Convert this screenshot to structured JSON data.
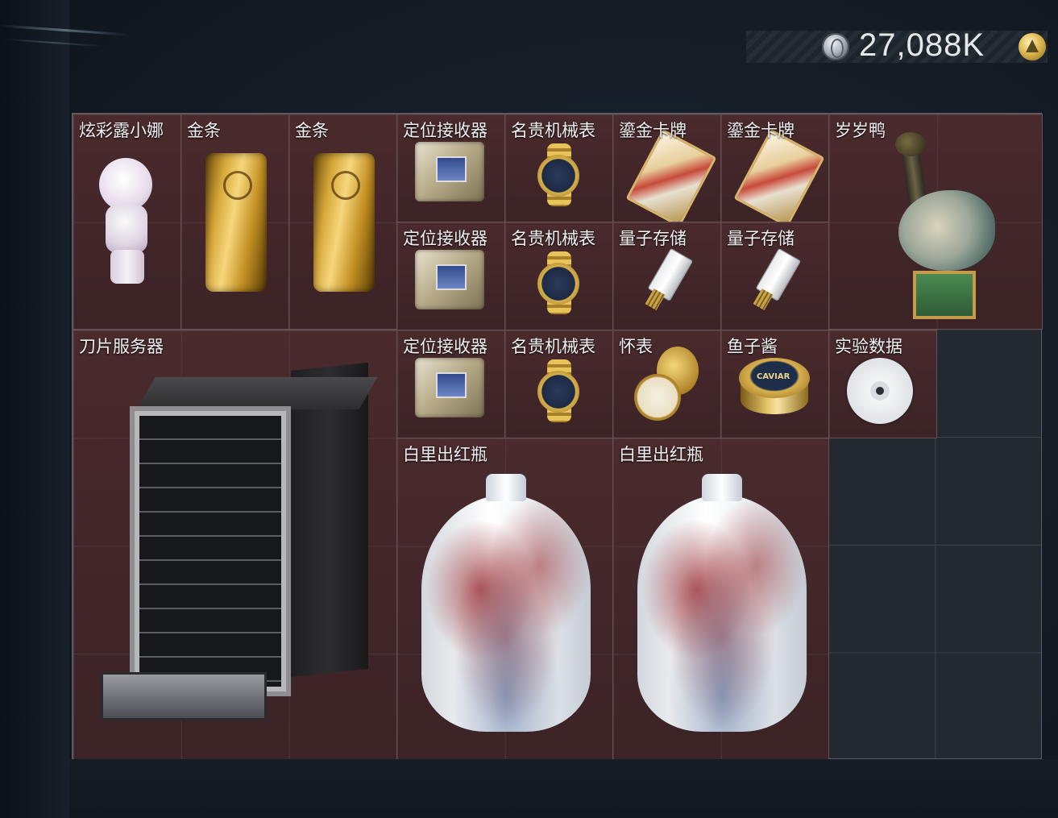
{
  "currency": {
    "value": "27,088K",
    "coin_icon": "silver-coin-icon",
    "tier_icon": "gold-triangle-badge-icon"
  },
  "items": [
    {
      "name": "炫彩露小娜",
      "icon": "figurine-icon"
    },
    {
      "name": "金条",
      "icon": "gold-bar-icon"
    },
    {
      "name": "金条",
      "icon": "gold-bar-icon"
    },
    {
      "name": "定位接收器",
      "icon": "locator-receiver-icon"
    },
    {
      "name": "名贵机械表",
      "icon": "luxury-watch-icon"
    },
    {
      "name": "鎏金卡牌",
      "icon": "gilded-card-icon"
    },
    {
      "name": "鎏金卡牌",
      "icon": "gilded-card-icon"
    },
    {
      "name": "岁岁鸭",
      "icon": "duck-statue-icon"
    },
    {
      "name": "定位接收器",
      "icon": "locator-receiver-icon"
    },
    {
      "name": "名贵机械表",
      "icon": "luxury-watch-icon"
    },
    {
      "name": "量子存储",
      "icon": "quantum-storage-icon"
    },
    {
      "name": "量子存储",
      "icon": "quantum-storage-icon"
    },
    {
      "name": "刀片服务器",
      "icon": "blade-server-icon"
    },
    {
      "name": "定位接收器",
      "icon": "locator-receiver-icon"
    },
    {
      "name": "名贵机械表",
      "icon": "luxury-watch-icon"
    },
    {
      "name": "怀表",
      "icon": "pocket-watch-icon"
    },
    {
      "name": "鱼子酱",
      "icon": "caviar-tin-icon"
    },
    {
      "name": "实验数据",
      "icon": "data-disc-icon"
    },
    {
      "name": "白里出红瓶",
      "icon": "porcelain-vase-icon"
    },
    {
      "name": "白里出红瓶",
      "icon": "porcelain-vase-icon"
    }
  ]
}
